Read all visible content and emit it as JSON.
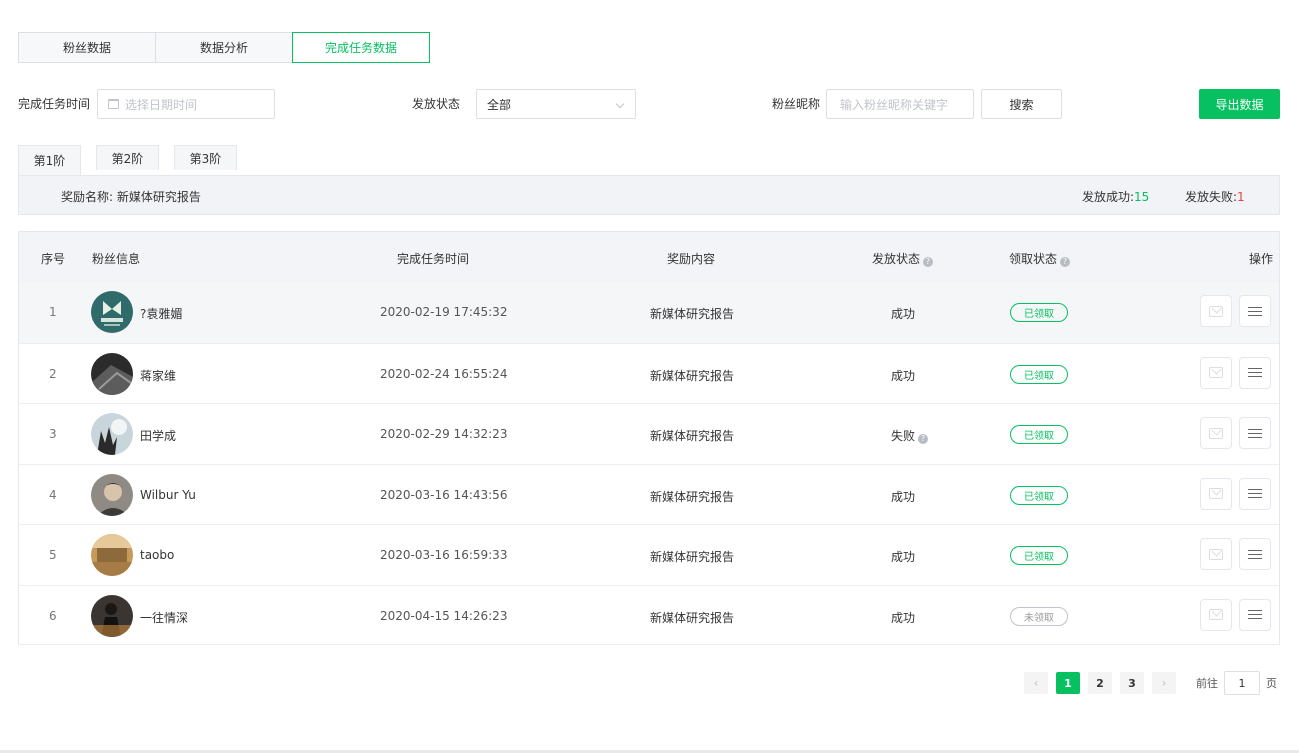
{
  "top_tabs": [
    {
      "label": "粉丝数据"
    },
    {
      "label": "数据分析"
    },
    {
      "label": "完成任务数据"
    }
  ],
  "filters": {
    "time_label": "完成任务时间",
    "time_placeholder": "选择日期时间",
    "status_label": "发放状态",
    "status_value": "全部",
    "nickname_label": "粉丝昵称",
    "nickname_placeholder": "输入粉丝昵称关键字",
    "search_label": "搜索",
    "export_label": "导出数据"
  },
  "stage_tabs": [
    {
      "label": "第1阶"
    },
    {
      "label": "第2阶"
    },
    {
      "label": "第3阶"
    }
  ],
  "reward": {
    "name_label": "奖励名称:",
    "name_value": "新媒体研究报告",
    "success_label": "发放成功:",
    "success_count": "15",
    "fail_label": "发放失败:",
    "fail_count": "1"
  },
  "table": {
    "headers": {
      "idx": "序号",
      "fan": "粉丝信息",
      "time": "完成任务时间",
      "reward": "奖励内容",
      "send_status": "发放状态",
      "claim_status": "领取状态",
      "action": "操作"
    },
    "rows": [
      {
        "idx": "1",
        "name": "?袁雅媚",
        "time": "2020-02-19 17:45:32",
        "reward": "新媒体研究报告",
        "status": "成功",
        "claim": "已领取"
      },
      {
        "idx": "2",
        "name": "蒋家维",
        "time": "2020-02-24 16:55:24",
        "reward": "新媒体研究报告",
        "status": "成功",
        "claim": "已领取"
      },
      {
        "idx": "3",
        "name": "田学成",
        "time": "2020-02-29 14:32:23",
        "reward": "新媒体研究报告",
        "status": "失败",
        "claim": "已领取"
      },
      {
        "idx": "4",
        "name": "Wilbur Yu",
        "time": "2020-03-16 14:43:56",
        "reward": "新媒体研究报告",
        "status": "成功",
        "claim": "已领取"
      },
      {
        "idx": "5",
        "name": "taobo",
        "time": "2020-03-16 16:59:33",
        "reward": "新媒体研究报告",
        "status": "成功",
        "claim": "已领取"
      },
      {
        "idx": "6",
        "name": "一往情深",
        "time": "2020-04-15 14:26:23",
        "reward": "新媒体研究报告",
        "status": "成功",
        "claim": "未领取"
      }
    ]
  },
  "pagination": {
    "prev": "‹",
    "pages": [
      "1",
      "2",
      "3"
    ],
    "next": "›",
    "current": "1",
    "goto_label": "前往",
    "goto_value": "1",
    "goto_suffix": "页"
  },
  "icons": {
    "calendar": "calendar-icon",
    "chevron": "chevron-down-icon",
    "help": "question-circle-icon",
    "mail": "mail-icon",
    "list": "list-icon"
  },
  "colors": {
    "accent": "#07c160",
    "fail_count": "#e64340"
  }
}
